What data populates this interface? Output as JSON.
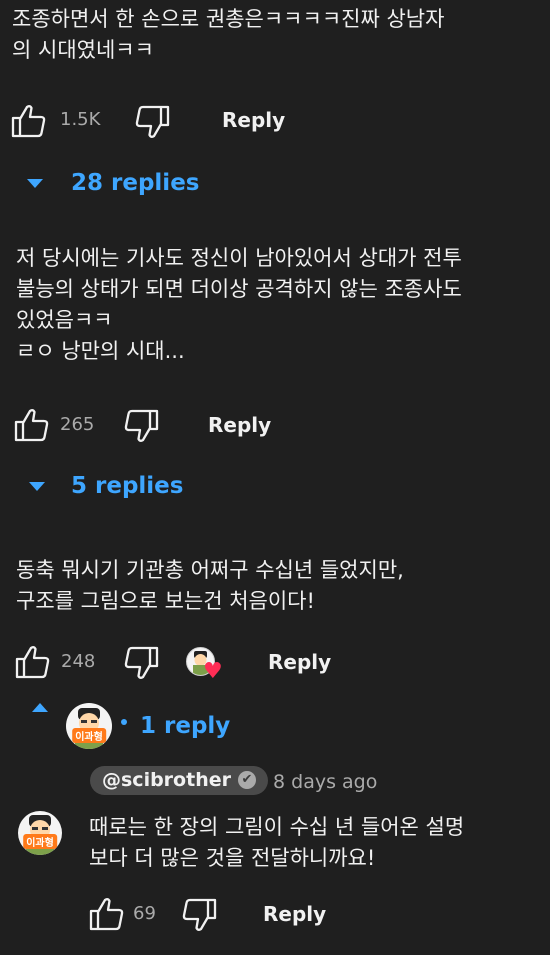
{
  "comments": [
    {
      "text_lines": [
        "조종하면서 한 손으로 권총은ㅋㅋㅋㅋ진짜 상남자",
        "의 시대였네ㅋㅋ"
      ],
      "likes": "1.5K",
      "reply_label": "Reply",
      "replies_toggle": "28 replies"
    },
    {
      "text_lines": [
        "저 당시에는 기사도 정신이 남아있어서 상대가 전투",
        "불능의 상태가 되면 더이상 공격하지 않는 조종사도",
        "있었음ㅋㅋ",
        "ㄹㅇ 낭만의 시대..."
      ],
      "likes": "265",
      "reply_label": "Reply",
      "replies_toggle": "5 replies"
    },
    {
      "text_lines": [
        "동축 뭐시기 기관총 어쩌구 수십년 들었지만,",
        "구조를 그림으로 보는건 처음이다!"
      ],
      "likes": "248",
      "reply_label": "Reply",
      "replies_toggle": "1 reply"
    }
  ],
  "creator_avatar": {
    "badge_text": "이과형",
    "heart_color": "#ff2d55"
  },
  "reply": {
    "handle": "@scibrother",
    "verified_glyph": "✔",
    "timestamp": "8 days ago",
    "text_lines": [
      "때로는 한 장의 그림이 수십 년 들어온 설명",
      "보다 더 많은 것을 전달하니까요!"
    ],
    "likes": "69",
    "reply_label": "Reply"
  },
  "icons": {
    "like": "thumbs-up-icon",
    "dislike": "thumbs-down-icon",
    "expand": "caret-down-icon",
    "collapse": "caret-up-icon"
  },
  "colors": {
    "background": "#1f1f1f",
    "text": "#f1f1f1",
    "muted": "#aaaaaa",
    "link": "#3ea6ff",
    "badge": "#ff7a1a"
  }
}
